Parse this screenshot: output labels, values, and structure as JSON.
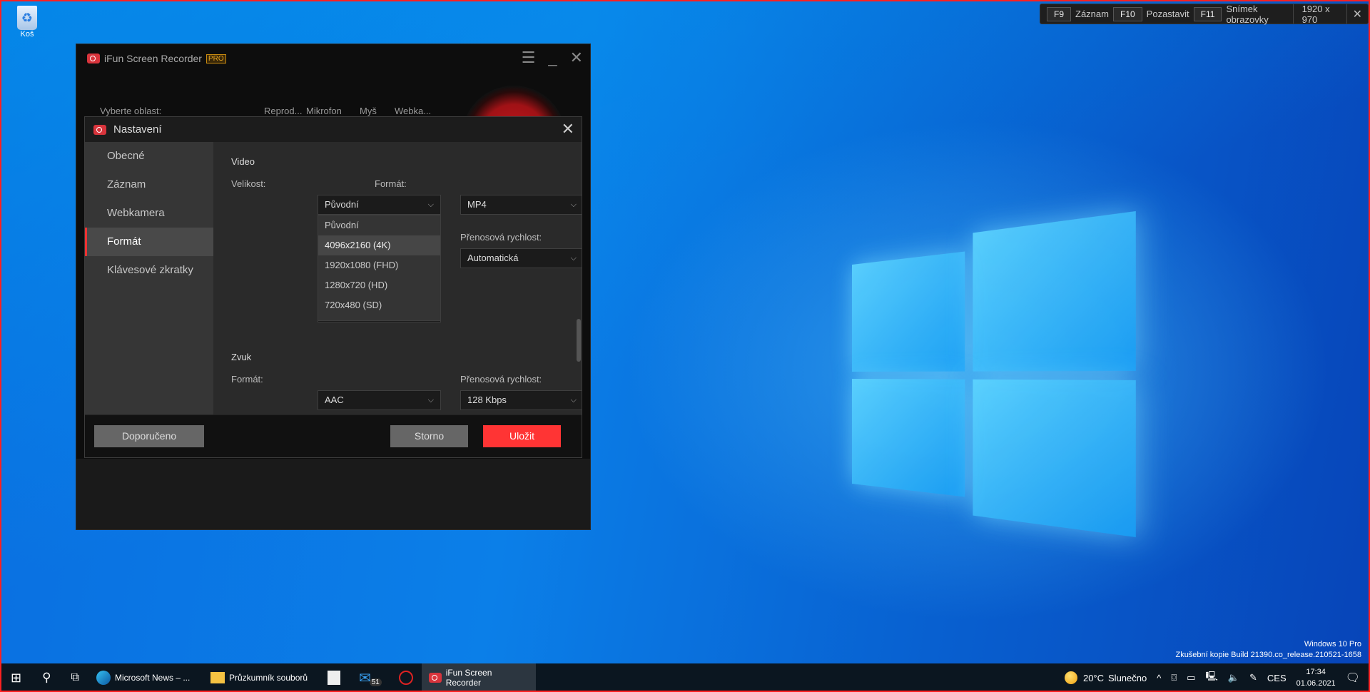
{
  "desktop": {
    "recycle_bin": "Koš",
    "watermark": [
      "Windows 10 Pro",
      "Zkušební kopie Build 21390.co_release.210521-1658"
    ]
  },
  "hotkeys": {
    "items": [
      {
        "key": "F9",
        "label": "Záznam"
      },
      {
        "key": "F10",
        "label": "Pozastavit"
      },
      {
        "key": "F11",
        "label": "Snímek obrazovky"
      }
    ],
    "resolution": "1920 x 970"
  },
  "app": {
    "title": "iFun Screen Recorder",
    "badge": "PRO",
    "select_area": "Vyberte oblast:",
    "toggles": [
      "Reprod...",
      "Mikrofon",
      "Myš",
      "Webka..."
    ]
  },
  "settings": {
    "title": "Nastavení",
    "sidebar": [
      {
        "label": "Obecné"
      },
      {
        "label": "Záznam"
      },
      {
        "label": "Webkamera"
      },
      {
        "label": "Formát",
        "active": true
      },
      {
        "label": "Klávesové zkratky"
      }
    ],
    "video": {
      "heading": "Video",
      "size_label": "Velikost:",
      "size_value": "Původní",
      "size_options": [
        "Původní",
        "4096x2160 (4K)",
        "1920x1080 (FHD)",
        "1280x720 (HD)",
        "720x480 (SD)"
      ],
      "size_highlighted": "4096x2160 (4K)",
      "format_label": "Formát:",
      "format_value": "MP4",
      "bitrate_label": "Přenosová rychlost:",
      "bitrate_value": "Automatická"
    },
    "audio": {
      "heading": "Zvuk",
      "format_label": "Formát:",
      "format_value": "AAC",
      "bitrate_label": "Přenosová rychlost:",
      "bitrate_value": "128 Kbps"
    },
    "buttons": {
      "recommended": "Doporučeno",
      "cancel": "Storno",
      "save": "Uložit"
    },
    "accent": "#ff3434"
  },
  "taskbar": {
    "apps": [
      {
        "label": "Microsoft News – ..."
      },
      {
        "label": "Průzkumník souborů"
      },
      {
        "label": "iFun Screen Recorder",
        "active": true
      }
    ],
    "mail_badge": "51",
    "weather": "20°C",
    "weather_text": "Slunečno",
    "lang": "CES",
    "time": "17:34",
    "date": "01.06.2021"
  }
}
